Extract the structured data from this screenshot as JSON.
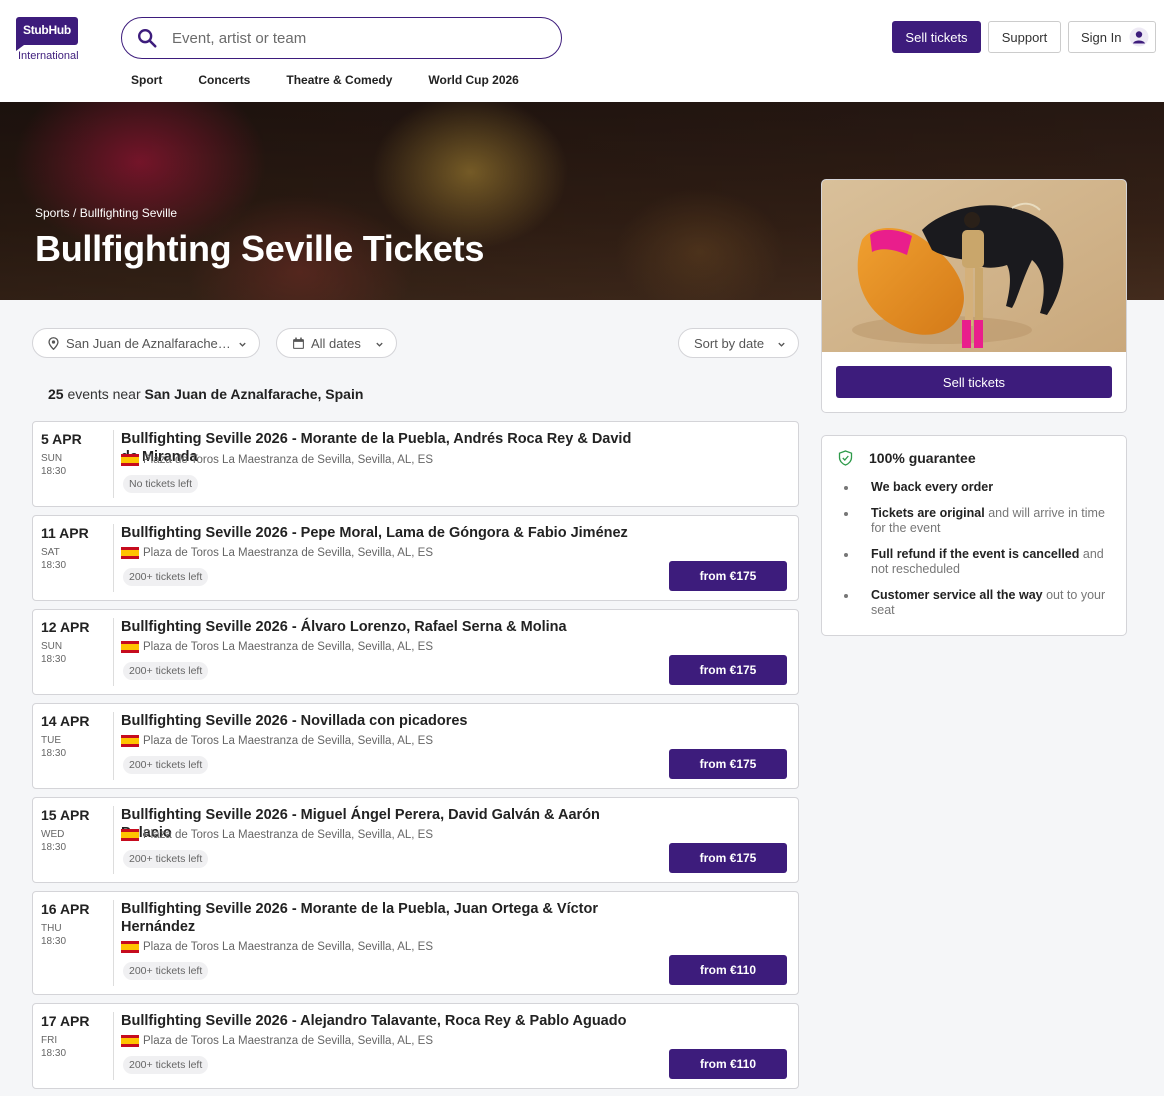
{
  "header": {
    "logo_text": "StubHub",
    "logo_sub": "International",
    "search_placeholder": "Event, artist or team",
    "nav": [
      "Sport",
      "Concerts",
      "Theatre & Comedy",
      "World Cup 2026"
    ],
    "sell_tickets": "Sell tickets",
    "support": "Support",
    "sign_in": "Sign In"
  },
  "hero": {
    "breadcrumb_root": "Sports",
    "breadcrumb_sep": " / ",
    "breadcrumb_current": "Bullfighting Seville",
    "title": "Bullfighting Seville Tickets"
  },
  "filters": {
    "location": "San Juan de Aznalfarache, Spain",
    "dates": "All dates",
    "sort": "Sort by date"
  },
  "summary": {
    "count": "25",
    "text": " events near ",
    "location": "San Juan de Aznalfarache, Spain"
  },
  "events": [
    {
      "day": "5 APR",
      "weekday": "SUN",
      "time": "18:30",
      "name": "Bullfighting Seville 2026 - Morante de la Puebla, Andrés Roca Rey & David de Miranda",
      "venue": "Plaza de Toros La Maestranza de Sevilla, Sevilla, AL, ES",
      "availability": "No tickets left",
      "price": ""
    },
    {
      "day": "11 APR",
      "weekday": "SAT",
      "time": "18:30",
      "name": "Bullfighting Seville 2026 - Pepe Moral, Lama de Góngora & Fabio Jiménez",
      "venue": "Plaza de Toros La Maestranza de Sevilla, Sevilla, AL, ES",
      "availability": "200+ tickets left",
      "price": "from €175"
    },
    {
      "day": "12 APR",
      "weekday": "SUN",
      "time": "18:30",
      "name": "Bullfighting Seville 2026 - Álvaro Lorenzo, Rafael Serna & Molina",
      "venue": "Plaza de Toros La Maestranza de Sevilla, Sevilla, AL, ES",
      "availability": "200+ tickets left",
      "price": "from €175"
    },
    {
      "day": "14 APR",
      "weekday": "TUE",
      "time": "18:30",
      "name": "Bullfighting Seville 2026 - Novillada con picadores",
      "venue": "Plaza de Toros La Maestranza de Sevilla, Sevilla, AL, ES",
      "availability": "200+ tickets left",
      "price": "from €175"
    },
    {
      "day": "15 APR",
      "weekday": "WED",
      "time": "18:30",
      "name": "Bullfighting Seville 2026 - Miguel Ángel Perera, David Galván & Aarón Palacio",
      "venue": "Plaza de Toros La Maestranza de Sevilla, Sevilla, AL, ES",
      "availability": "200+ tickets left",
      "price": "from €175"
    },
    {
      "day": "16 APR",
      "weekday": "THU",
      "time": "18:30",
      "name": "Bullfighting Seville 2026 - Morante de la Puebla, Juan Ortega & Víctor Hernández",
      "venue": "Plaza de Toros La Maestranza de Sevilla, Sevilla, AL, ES",
      "availability": "200+ tickets left",
      "price": "from €110"
    },
    {
      "day": "17 APR",
      "weekday": "FRI",
      "time": "18:30",
      "name": "Bullfighting Seville 2026 - Alejandro Talavante, Roca Rey & Pablo Aguado",
      "venue": "Plaza de Toros La Maestranza de Sevilla, Sevilla, AL, ES",
      "availability": "200+ tickets left",
      "price": "from €110"
    }
  ],
  "sidebar": {
    "sell_tickets": "Sell tickets",
    "guarantee_title": "100% guarantee",
    "guarantee_items": [
      {
        "bold": "We back every order",
        "rest": ""
      },
      {
        "bold": "Tickets are original",
        "rest": " and will arrive in time for the event"
      },
      {
        "bold": "Full refund if the event is cancelled",
        "rest": " and not rescheduled"
      },
      {
        "bold": "Customer service all the way",
        "rest": " out to your seat"
      }
    ]
  },
  "colors": {
    "brand": "#3d1c7c",
    "text": "#222222",
    "muted": "#666666",
    "guarantee_green": "#2e9a4a"
  }
}
